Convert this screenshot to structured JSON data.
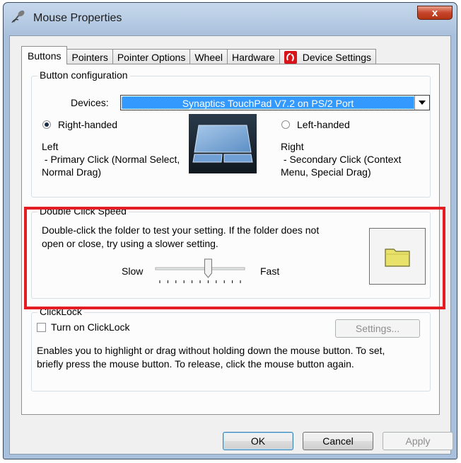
{
  "window": {
    "title": "Mouse Properties",
    "close_label": "x"
  },
  "tabs": [
    {
      "label": "Buttons",
      "active": true
    },
    {
      "label": "Pointers",
      "active": false
    },
    {
      "label": "Pointer Options",
      "active": false
    },
    {
      "label": "Wheel",
      "active": false
    },
    {
      "label": "Hardware",
      "active": false
    },
    {
      "label": "Device Settings",
      "active": false,
      "icon": "synaptics-icon"
    }
  ],
  "button_config": {
    "title": "Button configuration",
    "devices_label": "Devices:",
    "device_selected": "Synaptics TouchPad V7.2 on PS/2 Port",
    "right_handed": {
      "label": "Right-handed",
      "checked": true
    },
    "left_handed": {
      "label": "Left-handed",
      "checked": false
    },
    "left_desc": {
      "line1": "Left",
      "line2": " - Primary Click (Normal Select,",
      "line3": "Normal Drag)"
    },
    "right_desc": {
      "line1": "Right",
      "line2": " - Secondary Click (Context",
      "line3": "Menu, Special Drag)"
    }
  },
  "double_click": {
    "title": "Double Click Speed",
    "desc_line1": "Double-click the folder to test your setting.  If the folder does not",
    "desc_line2": "open or close, try using a slower setting.",
    "slow_label": "Slow",
    "fast_label": "Fast",
    "speed_fraction": 0.6
  },
  "clicklock": {
    "title": "ClickLock",
    "checkbox_label": "Turn on ClickLock",
    "checked": false,
    "settings_label": "Settings...",
    "desc_line1": "Enables you to highlight or drag without holding down the mouse button.  To set,",
    "desc_line2": "briefly press the mouse button.  To release, click the mouse button again."
  },
  "footer": {
    "ok_label": "OK",
    "cancel_label": "Cancel",
    "apply_label": "Apply"
  },
  "colors": {
    "highlight": "#e41c23",
    "selection": "#3399ff",
    "folder": "#e8e26a"
  }
}
